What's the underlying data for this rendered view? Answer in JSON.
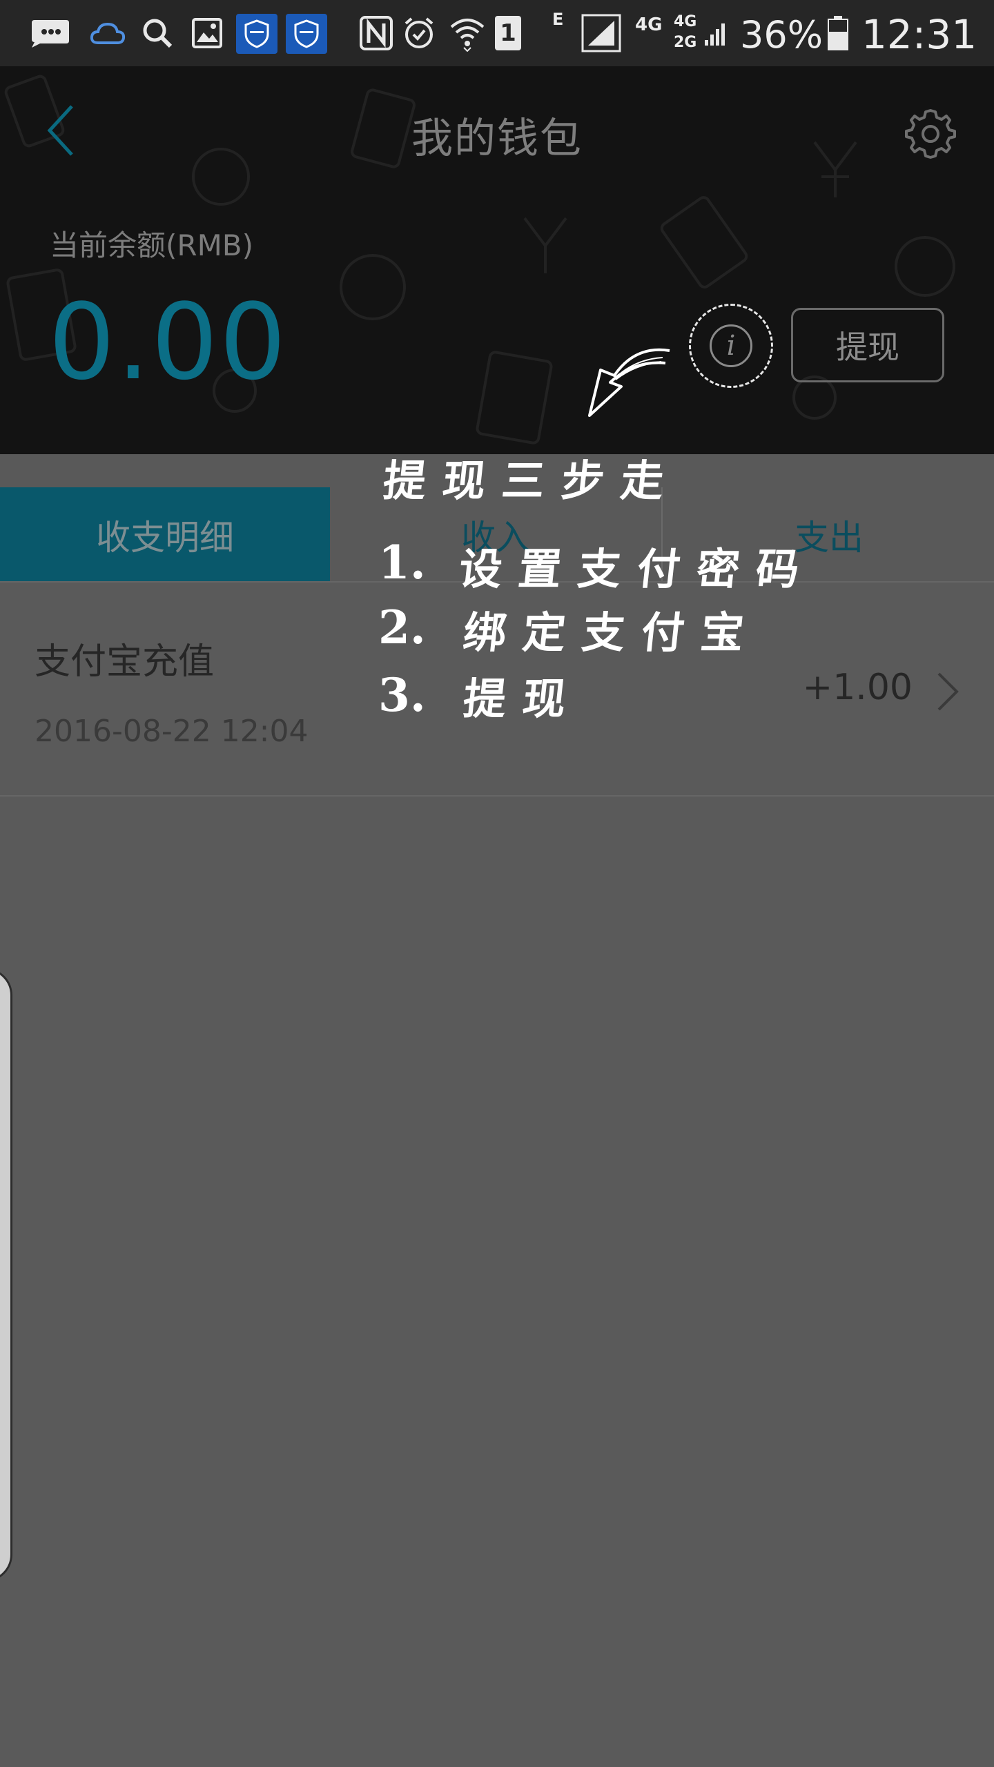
{
  "status_bar": {
    "battery_percent": "36%",
    "time": "12:31",
    "sim_slot": "1",
    "network_edge": "E",
    "network_4g": "4G",
    "network_4g_top": "4G",
    "network_2g": "2G",
    "icons": [
      "message-icon",
      "cloud-icon",
      "search-icon",
      "image-icon",
      "shield-app-icon",
      "shield-app-icon",
      "nfc-icon",
      "alarm-icon",
      "wifi-icon",
      "sim-icon",
      "signal-icon",
      "battery-icon"
    ]
  },
  "header": {
    "title": "我的钱包",
    "balance_label": "当前余额(RMB)",
    "balance_value": "0.00",
    "withdraw_label": "提现",
    "accent_color": "#0b6e86"
  },
  "tabs": [
    {
      "label": "收支明细",
      "active": true
    },
    {
      "label": "收入",
      "active": false
    },
    {
      "label": "支出",
      "active": false
    }
  ],
  "transactions": [
    {
      "name": "支付宝充值",
      "date": "2016-08-22 12:04",
      "amount": "+1.00"
    }
  ],
  "guide": {
    "heading": "提现三步走",
    "steps": [
      {
        "number": "1.",
        "text": "设置支付密码"
      },
      {
        "number": "2.",
        "text": "绑定支付宝"
      },
      {
        "number": "3.",
        "text": "提现"
      }
    ]
  }
}
